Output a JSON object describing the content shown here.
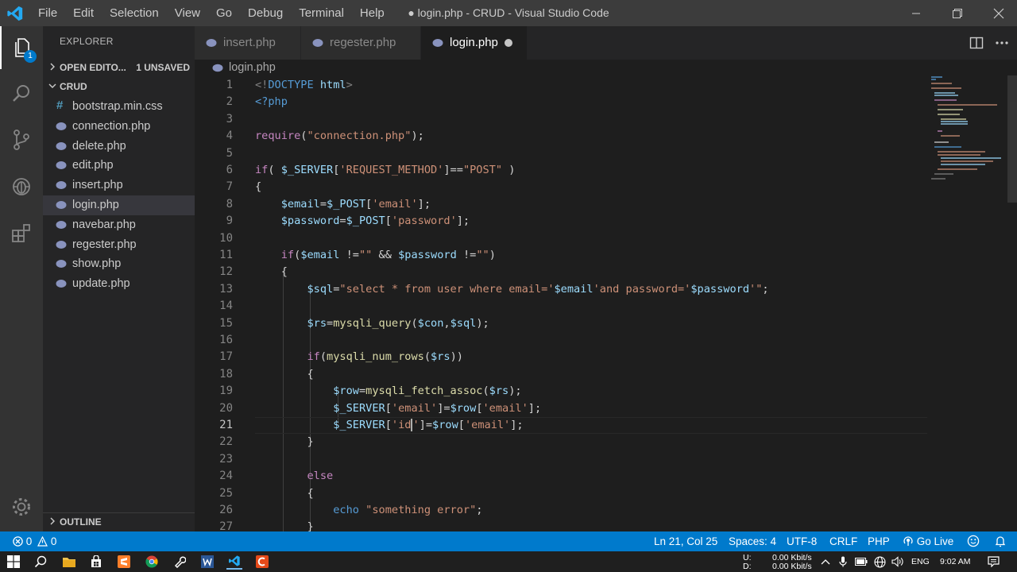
{
  "titlebar": {
    "menus": [
      "File",
      "Edit",
      "Selection",
      "View",
      "Go",
      "Debug",
      "Terminal",
      "Help"
    ],
    "window_title": "● login.php - CRUD - Visual Studio Code"
  },
  "activitybar": {
    "explorer_badge": "1"
  },
  "sidebar": {
    "header": "EXPLORER",
    "open_editors_label": "OPEN EDITO...",
    "unsaved_badge": "1 UNSAVED",
    "folder_label": "CRUD",
    "files": [
      {
        "name": "bootstrap.min.css",
        "type": "css"
      },
      {
        "name": "connection.php",
        "type": "php"
      },
      {
        "name": "delete.php",
        "type": "php"
      },
      {
        "name": "edit.php",
        "type": "php"
      },
      {
        "name": "insert.php",
        "type": "php"
      },
      {
        "name": "login.php",
        "type": "php",
        "active": true
      },
      {
        "name": "navebar.php",
        "type": "php"
      },
      {
        "name": "regester.php",
        "type": "php"
      },
      {
        "name": "show.php",
        "type": "php"
      },
      {
        "name": "update.php",
        "type": "php"
      }
    ],
    "outline_label": "OUTLINE"
  },
  "tabs": [
    {
      "label": "insert.php",
      "active": false
    },
    {
      "label": "regester.php",
      "active": false
    },
    {
      "label": "login.php",
      "active": true,
      "dirty": true
    }
  ],
  "breadcrumb": "login.php",
  "editor": {
    "line_numbers": [
      "1",
      "2",
      "3",
      "4",
      "5",
      "6",
      "7",
      "8",
      "9",
      "10",
      "11",
      "12",
      "13",
      "14",
      "15",
      "16",
      "17",
      "18",
      "19",
      "20",
      "21",
      "22",
      "23",
      "24",
      "25",
      "26",
      "27"
    ],
    "current_line": 21
  },
  "statusbar": {
    "errors": "0",
    "warnings": "0",
    "position": "Ln 21, Col 25",
    "spaces": "Spaces: 4",
    "encoding": "UTF-8",
    "eol": "CRLF",
    "language": "PHP",
    "golive": "Go Live"
  },
  "taskbar": {
    "net_up_label": "U:",
    "net_down_label": "D:",
    "net_up": "0.00 Kbit/s",
    "net_down": "0.00 Kbit/s",
    "lang": "ENG",
    "time": "9:02 AM"
  },
  "colors": {
    "accent": "#007acc",
    "php_icon": "#8993be",
    "css_icon": "#519aba"
  }
}
